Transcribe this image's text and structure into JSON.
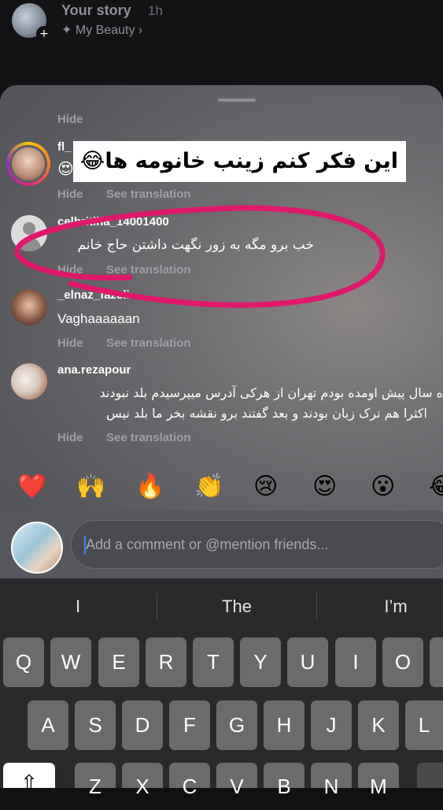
{
  "story": {
    "title": "Your story",
    "time": "1h",
    "beauty_label": "My Beauty",
    "sparkle": "✦",
    "chevron": "›",
    "plus": "+"
  },
  "overlay_text": "این فکر کنم زینب خانومه ها😂",
  "comments": [
    {
      "hide": "Hide"
    },
    {
      "username": "fl_",
      "text": "😍",
      "hide": "Hide",
      "translate": "See translation"
    },
    {
      "username": "celbritiha_14001400",
      "text": "خب برو مگه به زور نگهت داشتن حاج خانم",
      "hide": "Hide",
      "translate": "See translation"
    },
    {
      "username": "_elnaz_fazeli",
      "text": "Vaghaaaaaan",
      "hide": "Hide",
      "translate": "See translation"
    },
    {
      "username": "ana.rezapour",
      "line1": "ه سال پیش اومده بودم تهران از هرکی آدرس میپرسیدم بلد نبودند",
      "line2": "اکثرا هم ترک زبان بودند و بعد گفتند برو نقشه بخر ما بلد نیس",
      "hide": "Hide",
      "translate": "See translation"
    }
  ],
  "emojis": [
    "❤️",
    "🙌",
    "🔥",
    "👏",
    "😢",
    "😍",
    "😮",
    "😂"
  ],
  "composer": {
    "placeholder": "Add a comment or @mention friends..."
  },
  "suggestions": [
    "I",
    "The",
    "I’m"
  ],
  "keyboard": {
    "row1": [
      "Q",
      "W",
      "E",
      "R",
      "T",
      "Y",
      "U",
      "I",
      "O",
      "P"
    ],
    "row2": [
      "A",
      "S",
      "D",
      "F",
      "G",
      "H",
      "J",
      "K",
      "L"
    ],
    "row3": [
      "Z",
      "X",
      "C",
      "V",
      "B",
      "N",
      "M"
    ],
    "shift": "⇧"
  },
  "colors": {
    "highlight_circle": "#e0186c",
    "caret": "#3b82f6",
    "story_ring": "#d62976"
  }
}
